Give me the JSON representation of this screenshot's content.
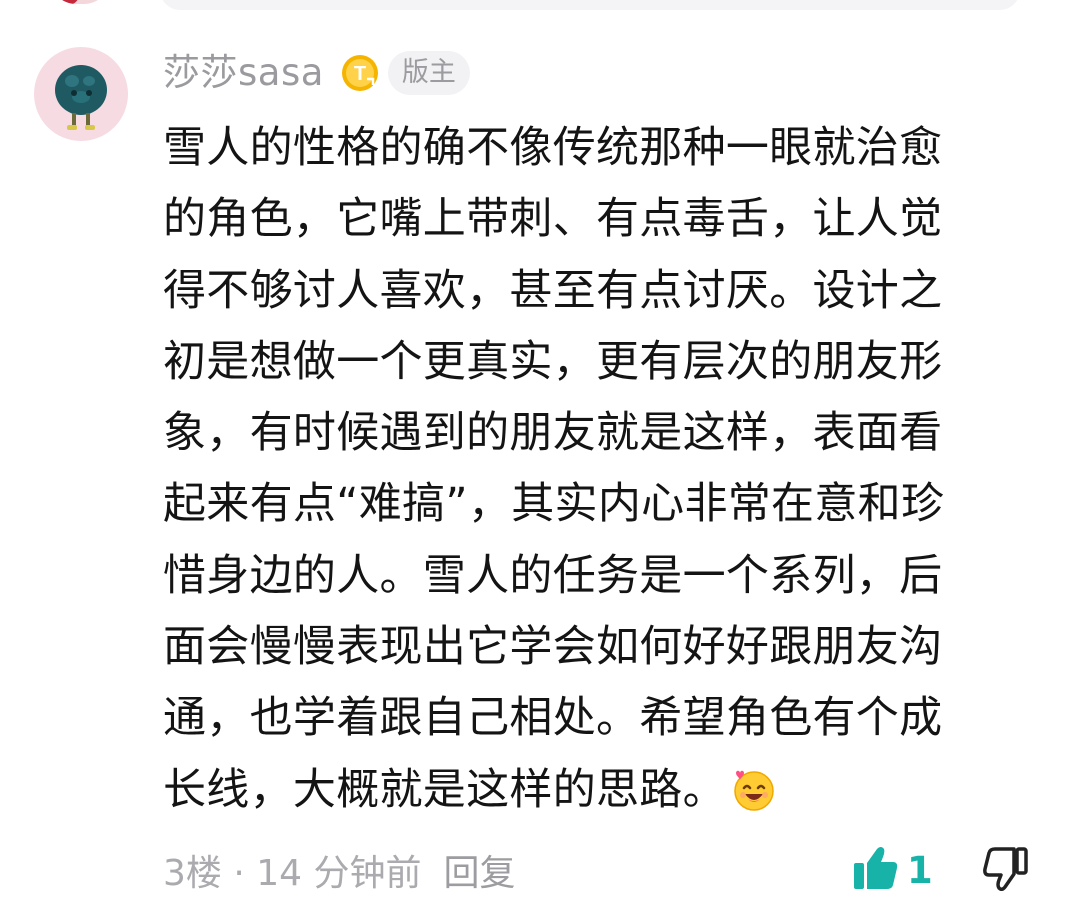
{
  "comment": {
    "username": "莎莎sasa",
    "level_badge_icon": "level-badge-icon",
    "role_badge": "版主",
    "content_lines": [
      "雪人的性格的确不像传统那种一眼就治愈",
      "的角色，它嘴上带刺、有点毒舌，让人觉",
      "得不够讨人喜欢，甚至有点讨厌。设计之",
      "初是想做一个更真实，更有层次的朋友形",
      "象，有时候遇到的朋友就是这样，表面看",
      "起来有点“难搞”，其实内心非常在意和珍",
      "惜身边的人。雪人的任务是一个系列，后",
      "面会慢慢表现出它学会如何好好跟朋友沟",
      "通，也学着跟自己相处。希望角色有个成",
      "长线，大概就是这样的思路。"
    ],
    "content_emoji": "smiling-face-with-heart-icon",
    "floor_time": "3楼 · 14 分钟前",
    "reply_label": "回复",
    "like_count": "1",
    "like_icon": "thumbs-up-icon",
    "dislike_icon": "thumbs-down-icon"
  },
  "colors": {
    "accent": "#17b3a8",
    "muted_text": "#9a9a9f",
    "body_text": "#141414",
    "badge_gold": "#f5b400"
  }
}
